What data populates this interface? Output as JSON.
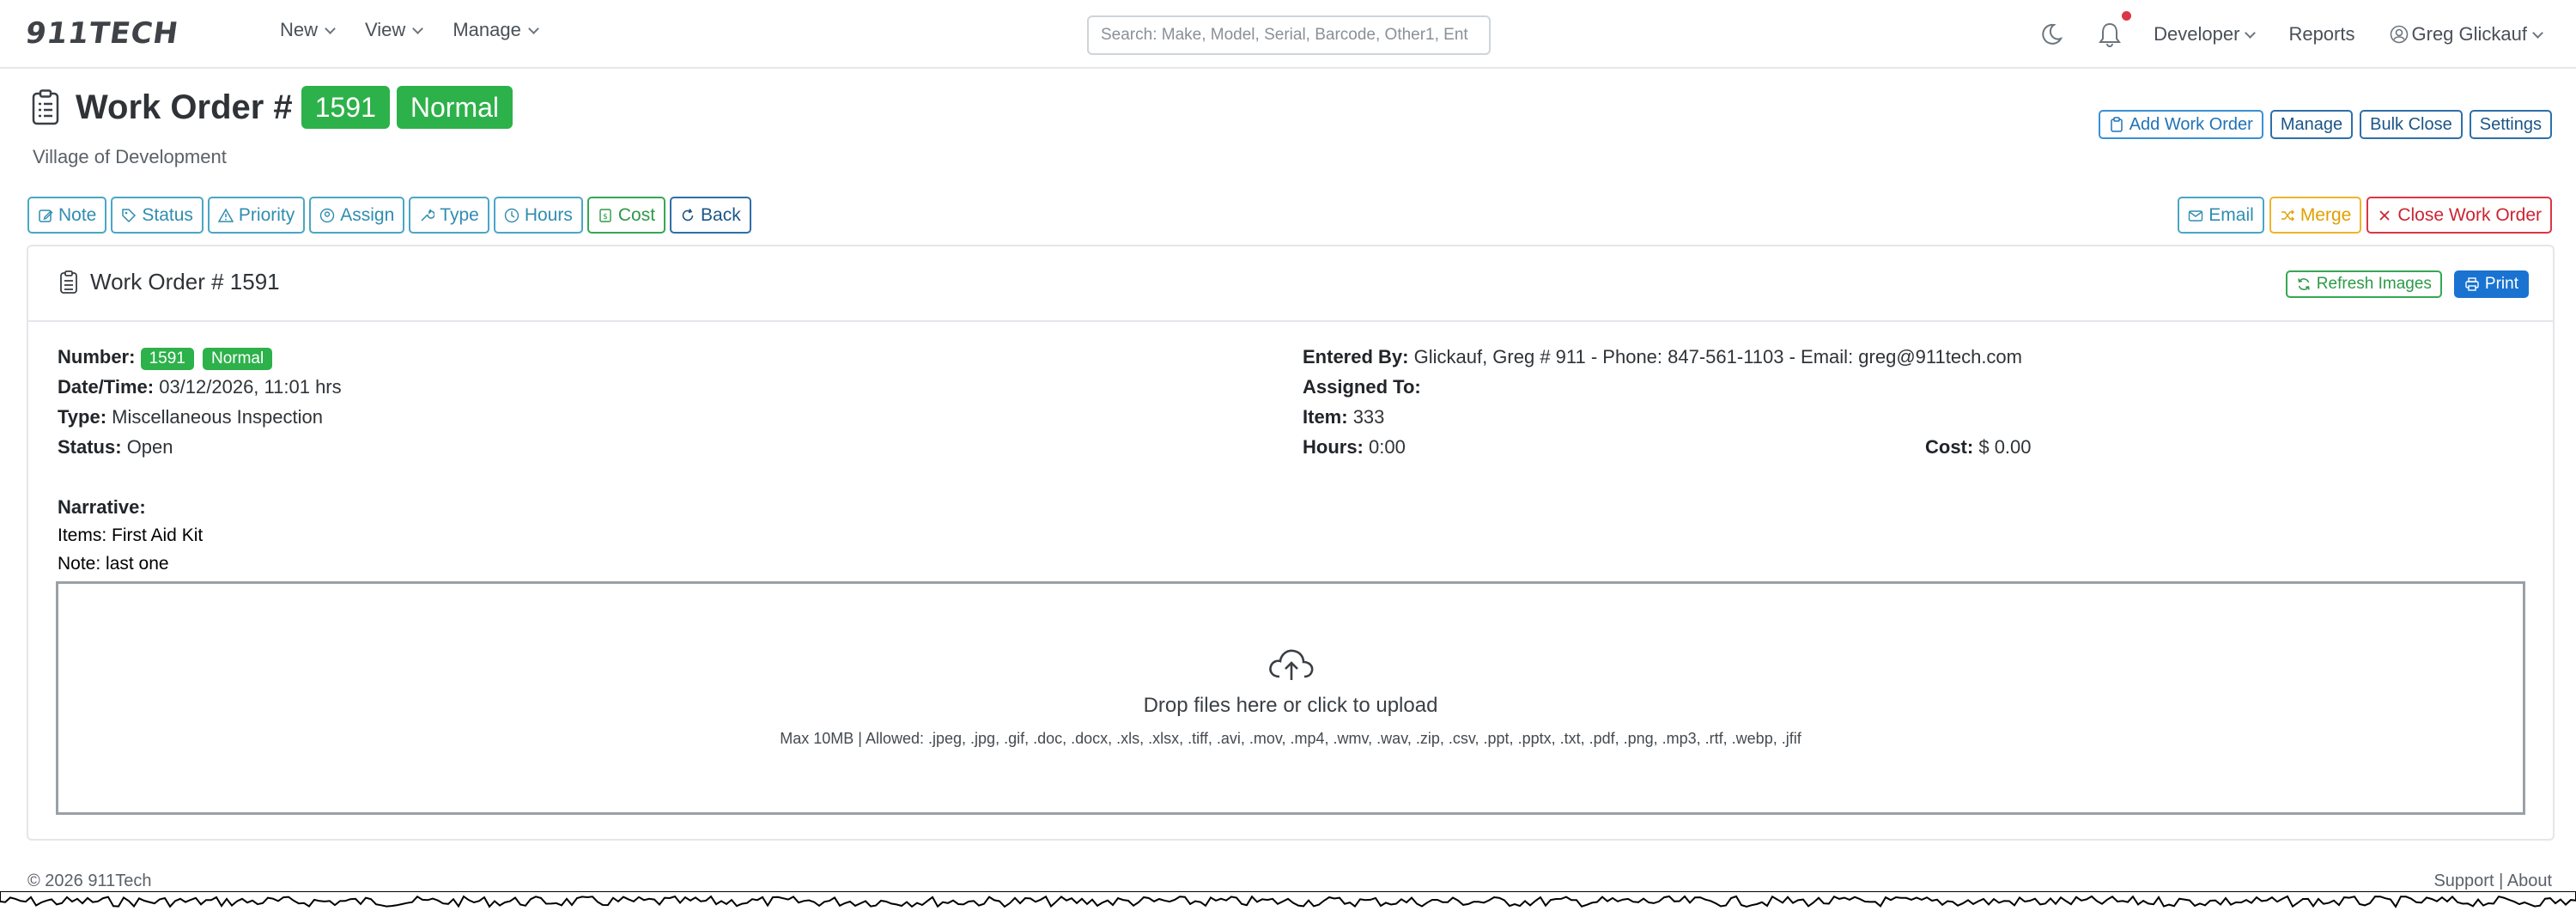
{
  "brand": {
    "logo": "911TECH"
  },
  "nav": {
    "menus": [
      "New",
      "View",
      "Manage"
    ],
    "search_placeholder": "Search: Make, Model, Serial, Barcode, Other1, Ent",
    "developer": "Developer",
    "reports": "Reports",
    "user": "Greg Glickauf"
  },
  "header": {
    "title": "Work Order #",
    "number": "1591",
    "priority": "Normal",
    "subtitle": "Village of Development",
    "actions": [
      "Add Work Order",
      "Manage",
      "Bulk Close",
      "Settings"
    ]
  },
  "toolbar": {
    "left": [
      "Note",
      "Status",
      "Priority",
      "Assign",
      "Type",
      "Hours",
      "Cost",
      "Back"
    ],
    "right": [
      "Email",
      "Merge",
      "Close Work Order"
    ]
  },
  "card": {
    "title": "Work Order # 1591",
    "refresh_label": "Refresh Images",
    "print_label": "Print"
  },
  "details": {
    "number_label": "Number:",
    "number": "1591",
    "priority": "Normal",
    "datetime_label": "Date/Time:",
    "datetime": "03/12/2026, 11:01 hrs",
    "type_label": "Type:",
    "type": "Miscellaneous Inspection",
    "status_label": "Status:",
    "status": "Open",
    "entered_by_label": "Entered By:",
    "entered_by": "Glickauf, Greg # 911 - Phone: 847-561-1103 - Email: greg@911tech.com",
    "assigned_to_label": "Assigned To:",
    "assigned_to": "",
    "item_label": "Item:",
    "item": "333",
    "hours_label": "Hours:",
    "hours": "0:00",
    "cost_label": "Cost:",
    "cost": "$ 0.00",
    "narrative_label": "Narrative:",
    "items_line": "Items: First Aid Kit",
    "note_line": "Note: last one"
  },
  "upload": {
    "title": "Drop files here or click to upload",
    "hint": "Max 10MB | Allowed: .jpeg, .jpg, .gif, .doc, .docx, .xls, .xlsx, .tiff, .avi, .mov, .mp4, .wmv, .wav, .zip, .csv, .ppt, .pptx, .txt, .pdf, .png, .mp3, .rtf, .webp, .jfif"
  },
  "footer": {
    "copyright": "© 2026 911Tech",
    "support": "Support",
    "separator": "|",
    "about": "About"
  },
  "colors": {
    "badge_green": "#2db14a",
    "primary": "#1a73d1",
    "danger": "#dc3545",
    "warning": "#f0b429"
  }
}
